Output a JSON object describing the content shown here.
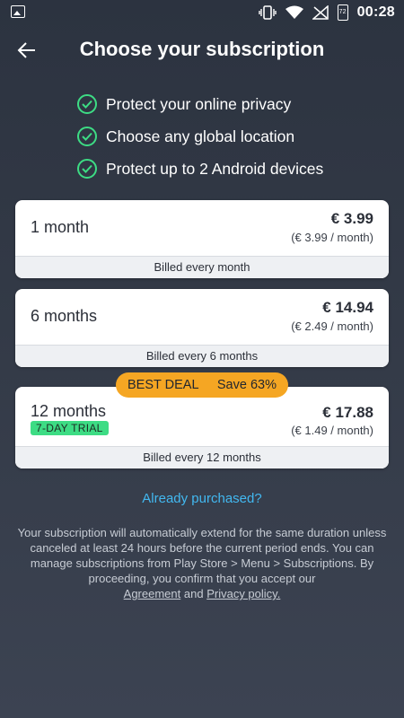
{
  "status_bar": {
    "time": "00:28",
    "battery_level": "72"
  },
  "header": {
    "title": "Choose your subscription"
  },
  "features": [
    {
      "label": "Protect your online privacy"
    },
    {
      "label": "Choose any global location"
    },
    {
      "label": "Protect up to 2 Android devices"
    }
  ],
  "plans": [
    {
      "duration": "1 month",
      "price": "€ 3.99",
      "per_month": "(€ 3.99 / month)",
      "billed": "Billed every month"
    },
    {
      "duration": "6 months",
      "price": "€ 14.94",
      "per_month": "(€ 2.49 / month)",
      "billed": "Billed every 6 months"
    },
    {
      "duration": "12 months",
      "price": "€ 17.88",
      "per_month": "(€ 1.49 / month)",
      "billed": "Billed every 12 months",
      "trial": "7-DAY TRIAL"
    }
  ],
  "deal_badge": {
    "label": "BEST DEAL",
    "save": "Save 63%"
  },
  "already_purchased": "Already purchased?",
  "legal": {
    "text": "Your subscription will automatically extend for the same duration unless canceled at least 24 hours before the current period ends. You can manage subscriptions from Play Store > Menu > Subscriptions. By proceeding, you confirm that you accept our",
    "agreement_link": "Agreement",
    "and": "and",
    "privacy_link": "Privacy policy."
  },
  "colors": {
    "accent_green": "#3ddc84",
    "deal_orange": "#f5a623",
    "link_blue": "#42b8f0",
    "background": "#2c3340"
  }
}
